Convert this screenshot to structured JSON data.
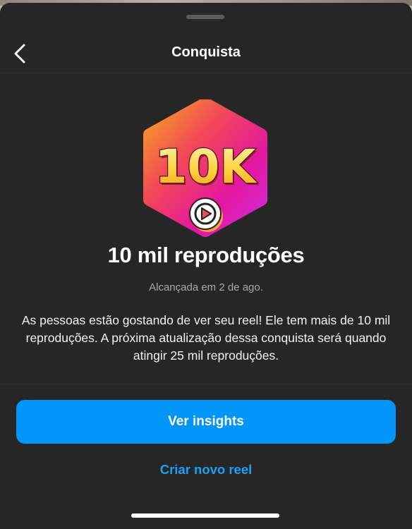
{
  "header": {
    "back_icon": "chevron-left-icon",
    "title": "Conquista"
  },
  "badge": {
    "text": "10K",
    "icon": "play-icon",
    "gradient_colors": [
      "#f7a224",
      "#f24a56",
      "#e3179e",
      "#d12bd8"
    ]
  },
  "achievement": {
    "title": "10 mil reproduções",
    "date": "Alcançada em 2 de ago.",
    "description": "As pessoas estão gostando de ver seu reel! Ele tem mais de 10 mil reproduções. A próxima atualização dessa conquista será quando atingir 25 mil reproduções."
  },
  "actions": {
    "primary_label": "Ver insights",
    "secondary_label": "Criar novo reel"
  },
  "colors": {
    "background": "#262626",
    "accent": "#0095f6",
    "link": "#1aa1f7"
  }
}
